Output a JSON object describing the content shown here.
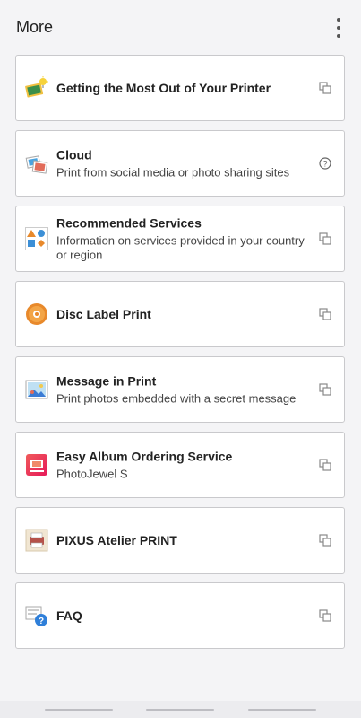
{
  "header": {
    "title": "More"
  },
  "items": [
    {
      "title": "Getting the Most Out of Your Printer",
      "subtitle": "",
      "icon": "lightbulb-photo-icon",
      "action_icon": "open-external-icon"
    },
    {
      "title": "Cloud",
      "subtitle": "Print from social media or photo sharing sites",
      "icon": "cloud-photos-icon",
      "action_icon": "help-circle-icon"
    },
    {
      "title": "Recommended Services",
      "subtitle": "Information on services provided in your country or region",
      "icon": "shapes-icon",
      "action_icon": "open-external-icon"
    },
    {
      "title": "Disc Label Print",
      "subtitle": "",
      "icon": "disc-icon",
      "action_icon": "open-external-icon"
    },
    {
      "title": "Message in Print",
      "subtitle": "Print photos embedded with a secret message",
      "icon": "message-photo-icon",
      "action_icon": "open-external-icon"
    },
    {
      "title": "Easy Album Ordering Service",
      "subtitle": "PhotoJewel S",
      "icon": "album-icon",
      "action_icon": "open-external-icon"
    },
    {
      "title": "PIXUS Atelier PRINT",
      "subtitle": "",
      "icon": "atelier-icon",
      "action_icon": "open-external-icon"
    },
    {
      "title": "FAQ",
      "subtitle": "",
      "icon": "faq-icon",
      "action_icon": "open-external-icon"
    }
  ],
  "colors": {
    "accent_orange": "#e8892b",
    "help_gray": "#666666",
    "border": "#c9c9cc"
  }
}
